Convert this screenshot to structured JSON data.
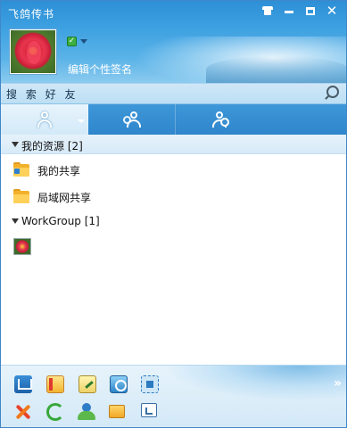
{
  "window": {
    "title": "飞鸽传书"
  },
  "profile": {
    "signature_placeholder": "编辑个性签名",
    "status": "online"
  },
  "search": {
    "placeholder": "搜 索 好 友"
  },
  "tabs": [
    {
      "name": "contacts",
      "icon": "person-icon",
      "active": true
    },
    {
      "name": "groups",
      "icon": "people-icon",
      "active": false
    },
    {
      "name": "recent",
      "icon": "recent-contacts-icon",
      "active": false
    }
  ],
  "groups": [
    {
      "label": "我的资源 [2]",
      "expanded": true,
      "items": [
        {
          "label": "我的共享",
          "icon": "shared-folder-icon"
        },
        {
          "label": "局域网共享",
          "icon": "lan-folder-icon"
        }
      ]
    },
    {
      "label": "WorkGroup [1]",
      "expanded": true,
      "items": [
        {
          "label": "",
          "icon": "user-avatar-icon"
        }
      ]
    }
  ],
  "toolbar": {
    "row1": [
      "save-icon",
      "notebook-icon",
      "notes-icon",
      "screenshot-icon",
      "capture-icon"
    ],
    "row2": [
      "tools-icon",
      "refresh-icon",
      "user-manager-icon",
      "folder-icon",
      "message-icon"
    ]
  },
  "colors": {
    "header_blue": "#3c9fe0",
    "tab_bar": "#2f86cc",
    "accent_orange": "#f2b12c"
  }
}
